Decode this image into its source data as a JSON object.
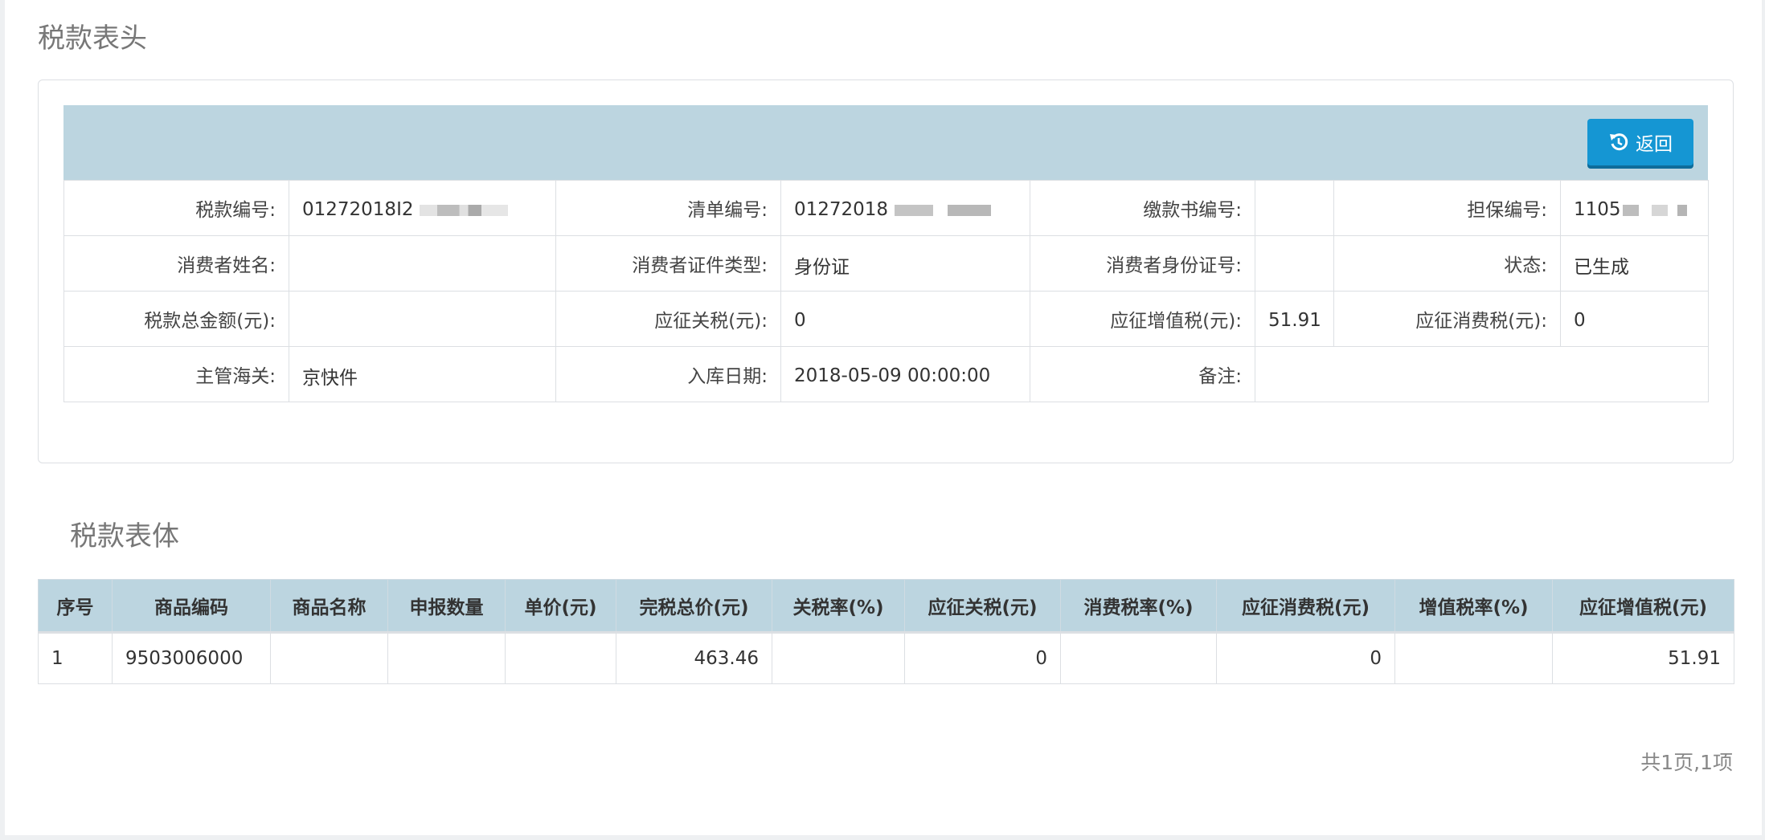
{
  "header_section": {
    "title": "税款表头",
    "back_label": "返回",
    "fields": {
      "tax_no_label": "税款编号:",
      "tax_no_value": "01272018I2",
      "list_no_label": "清单编号:",
      "list_no_value": "01272018",
      "payment_no_label": "缴款书编号:",
      "payment_no_value": "",
      "guarantee_no_label": "担保编号:",
      "guarantee_no_value": "1105",
      "consumer_name_label": "消费者姓名:",
      "consumer_name_value": "",
      "id_type_label": "消费者证件类型:",
      "id_type_value": "身份证",
      "id_no_label": "消费者身份证号:",
      "id_no_value": "",
      "status_label": "状态:",
      "status_value": "已生成",
      "total_label": "税款总金额(元):",
      "total_value": "",
      "customs_duty_label": "应征关税(元):",
      "customs_duty_value": "0",
      "vat_label": "应征增值税(元):",
      "vat_value": "51.91",
      "consumption_tax_label": "应征消费税(元):",
      "consumption_tax_value": "0",
      "customs_office_label": "主管海关:",
      "customs_office_value": "京快件",
      "storage_date_label": "入库日期:",
      "storage_date_value": "2018-05-09 00:00:00",
      "remark_label": "备注:",
      "remark_value": ""
    }
  },
  "body_section": {
    "title": "税款表体",
    "columns": [
      "序号",
      "商品编码",
      "商品名称",
      "申报数量",
      "单价(元)",
      "完税总价(元)",
      "关税率(%)",
      "应征关税(元)",
      "消费税率(%)",
      "应征消费税(元)",
      "增值税率(%)",
      "应征增值税(元)"
    ],
    "rows": [
      [
        "1",
        "9503006000",
        "",
        "",
        "",
        "463.46",
        "",
        "0",
        "",
        "0",
        "",
        "51.91"
      ]
    ]
  },
  "pagination": {
    "summary": "共1页,1项"
  },
  "colors": {
    "header_bar": "#bcd5e0",
    "button": "#1596d3"
  }
}
